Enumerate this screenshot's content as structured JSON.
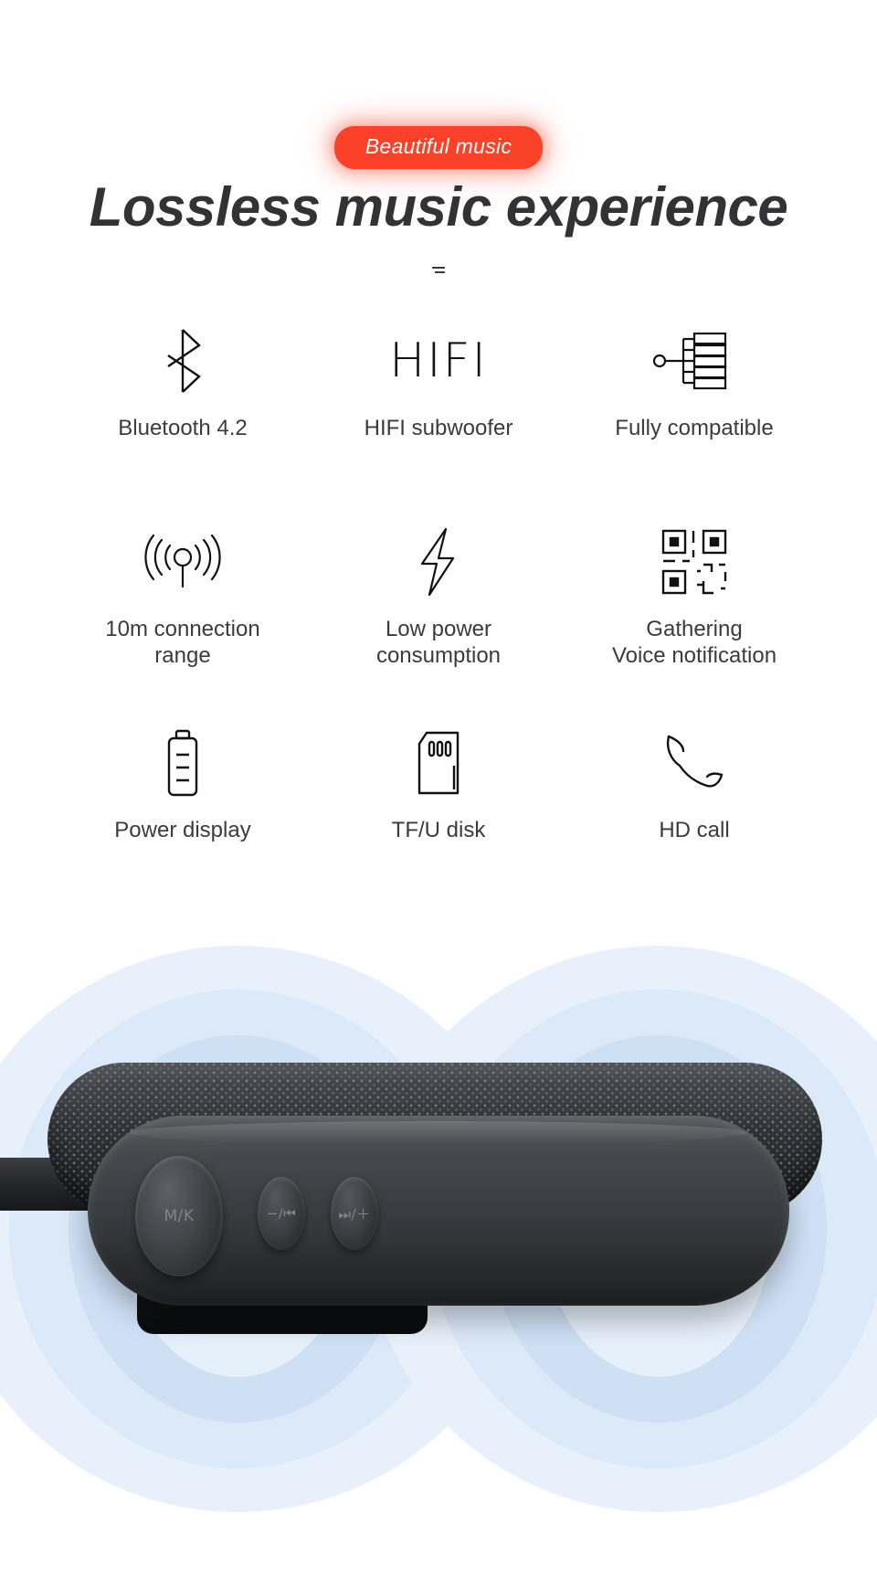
{
  "badge": {
    "label": "Beautiful music",
    "color": "#fb4229",
    "text_color": "#ffffff"
  },
  "heading": {
    "text": "Lossless music experience",
    "color": "#333335"
  },
  "divider": {
    "icon": "small-dashes-divider"
  },
  "features": [
    {
      "icon": "bluetooth-icon",
      "label": "Bluetooth 4.2"
    },
    {
      "icon": "hifi-wordmark-icon",
      "label": "HIFI subwoofer",
      "glyph_text": "HIFI"
    },
    {
      "icon": "compatibility-tree-icon",
      "label": "Fully compatible"
    },
    {
      "icon": "antenna-signal-icon",
      "label": "10m connection\nrange"
    },
    {
      "icon": "lightning-bolt-icon",
      "label": "Low power\nconsumption"
    },
    {
      "icon": "qr-code-icon",
      "label": "Gathering\nVoice notification"
    },
    {
      "icon": "battery-icon",
      "label": "Power display"
    },
    {
      "icon": "sd-card-icon",
      "label": "TF/U disk"
    },
    {
      "icon": "phone-handset-icon",
      "label": "HD call"
    }
  ],
  "hero": {
    "product": "bluetooth-speaker",
    "halo_color": "#cfe0f5",
    "buttons": [
      {
        "name": "power-button",
        "glyph": "M/K"
      },
      {
        "name": "previous-button",
        "glyph": "−/⏮"
      },
      {
        "name": "next-button",
        "glyph": "⏭/＋"
      }
    ]
  }
}
